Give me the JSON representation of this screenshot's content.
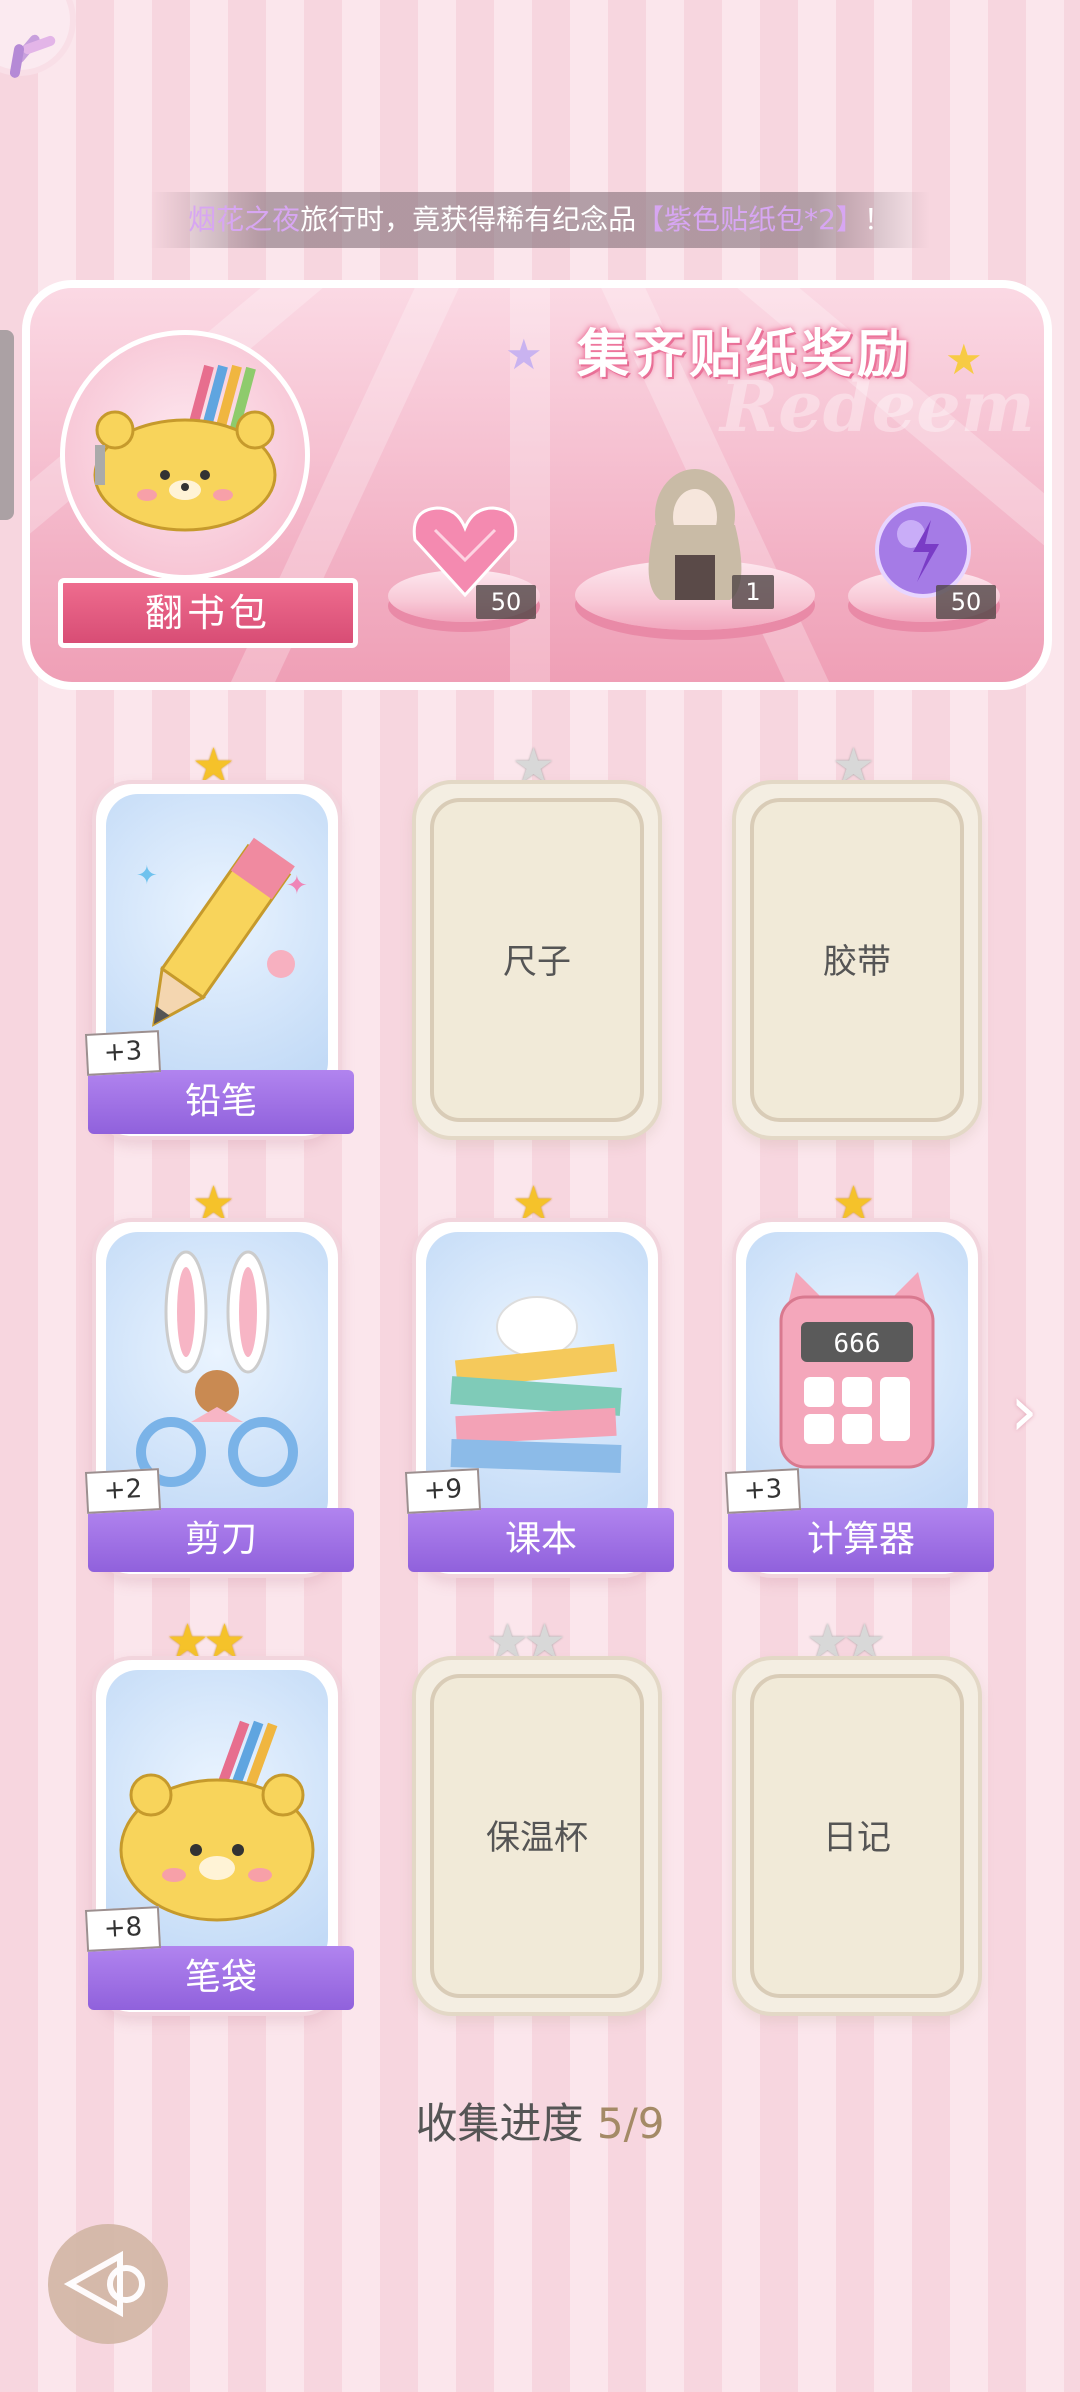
{
  "notice": {
    "place": "烟花之夜",
    "middle": "旅行时，竟获得稀有纪念品",
    "item": "【紫色贴纸包*2】",
    "end": "！"
  },
  "banner": {
    "title": "集齐贴纸奖励",
    "watermark": "Redeem",
    "open_bag_label": "翻书包",
    "rewards": [
      {
        "icon": "pink-diamond-heart-icon",
        "qty": "50"
      },
      {
        "icon": "outfit-portrait-icon",
        "qty": "1"
      },
      {
        "icon": "purple-energy-orb-icon",
        "qty": "50"
      }
    ]
  },
  "cards": [
    {
      "name": "铅笔",
      "collected": true,
      "bonus": "+3",
      "stars": 1,
      "icon": "pencil-icon"
    },
    {
      "name": "尺子",
      "collected": false,
      "stars": 1
    },
    {
      "name": "胶带",
      "collected": false,
      "stars": 1
    },
    {
      "name": "剪刀",
      "collected": true,
      "bonus": "+2",
      "stars": 1,
      "icon": "scissors-icon"
    },
    {
      "name": "课本",
      "collected": true,
      "bonus": "+9",
      "stars": 1,
      "icon": "textbooks-icon"
    },
    {
      "name": "计算器",
      "collected": true,
      "bonus": "+3",
      "stars": 1,
      "icon": "calculator-icon"
    },
    {
      "name": "笔袋",
      "collected": true,
      "bonus": "+8",
      "stars": 2,
      "icon": "pencil-case-icon"
    },
    {
      "name": "保温杯",
      "collected": false,
      "stars": 2
    },
    {
      "name": "日记",
      "collected": false,
      "stars": 2
    }
  ],
  "calculator_display": "666",
  "progress": {
    "label": "收集进度",
    "value": "5/9"
  },
  "colors": {
    "label_purple": "#9a6be4",
    "gold_star": "#f5c22a",
    "banner_pink": "#f4b9cb"
  }
}
